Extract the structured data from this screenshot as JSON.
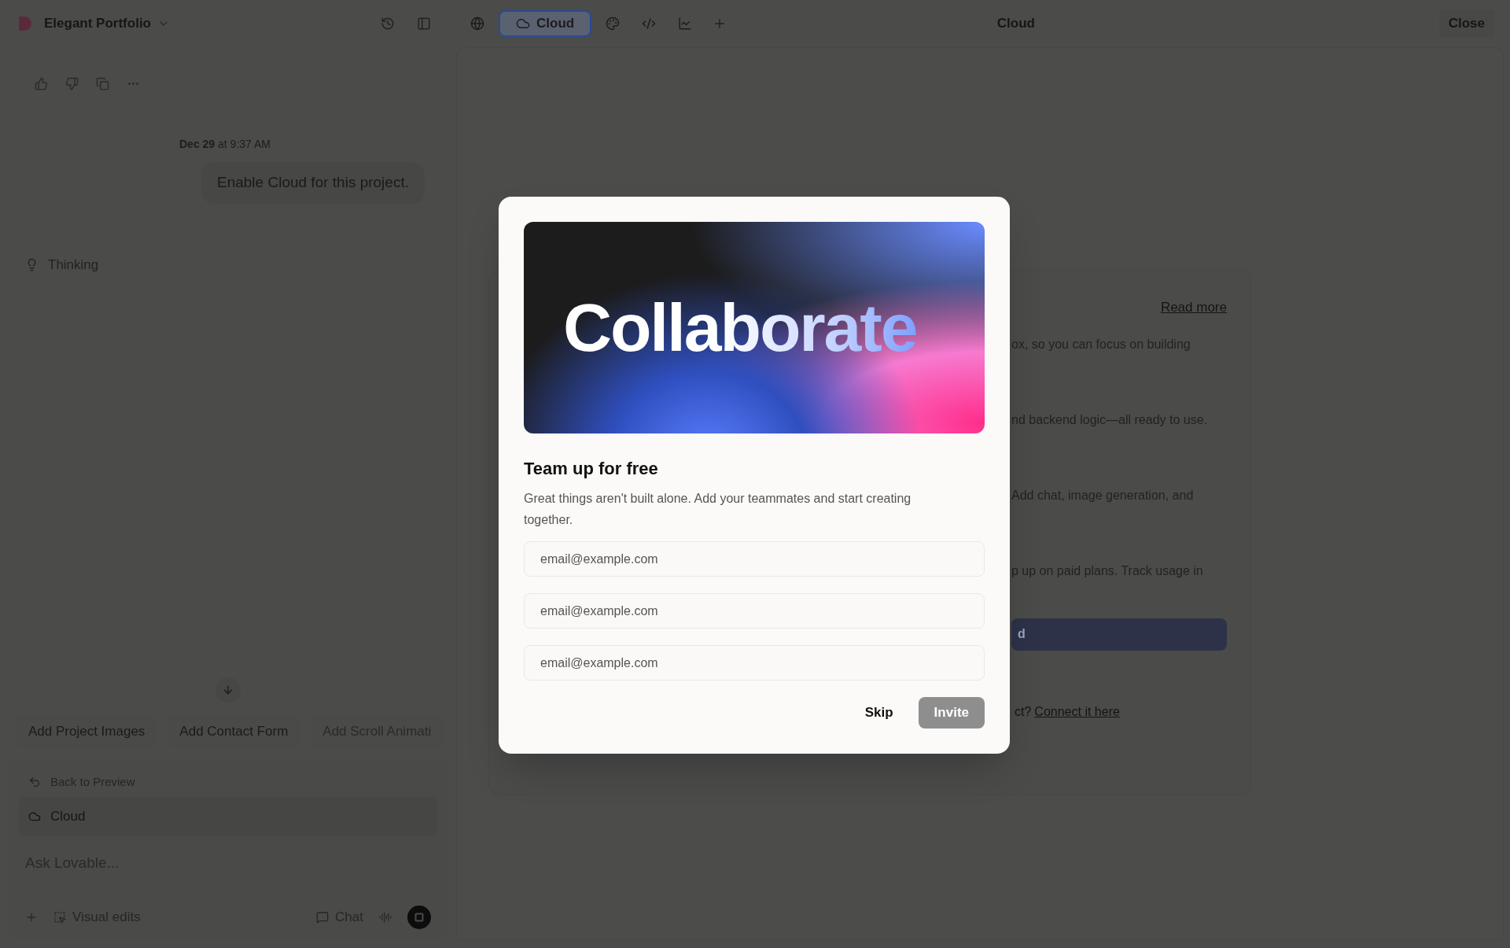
{
  "top_bar": {
    "project_name": "Elegant Portfolio",
    "view_tabs": [
      {
        "selected": false
      },
      {
        "label": "Cloud",
        "selected": true
      },
      {
        "selected": false
      },
      {
        "selected": false
      },
      {
        "selected": false
      }
    ],
    "panel_title": "Cloud",
    "close": "Close"
  },
  "chat": {
    "timestamp": "**Dec 29** at 9:37 AM",
    "message": "Enable Cloud for this project.",
    "status": "Thinking"
  },
  "suggestions": [
    "Add Project Images",
    "Add Contact Form",
    "Add Scroll Animati"
  ],
  "composer": {
    "context_items": [
      {
        "label": "Back to Preview",
        "selected": false
      },
      {
        "label": "Cloud",
        "selected": true
      }
    ],
    "placeholder": "Ask Lovable...",
    "visual_edits": "Visual edits",
    "mode": "Chat"
  },
  "cloud_card": {
    "link": "Read more",
    "lines": [
      "ox, so you can focus on building",
      "nd backend logic—all ready to use.",
      "Add chat, image generation, and",
      "p up on paid plans. Track usage in"
    ],
    "button": "d",
    "footer": "ct?",
    "footer_link": "Connect it here"
  },
  "modal": {
    "banner_text": "Collaborate",
    "title": "Team up for free",
    "description": "Great things aren't built alone. Add your teammates and start creating together.",
    "email_fields": [
      {
        "placeholder": "email@example.com"
      },
      {
        "placeholder": "email@example.com"
      },
      {
        "placeholder": "email@example.com"
      }
    ],
    "skip": "Skip",
    "invite": {
      "label": "Invite",
      "disabled": true
    }
  }
}
